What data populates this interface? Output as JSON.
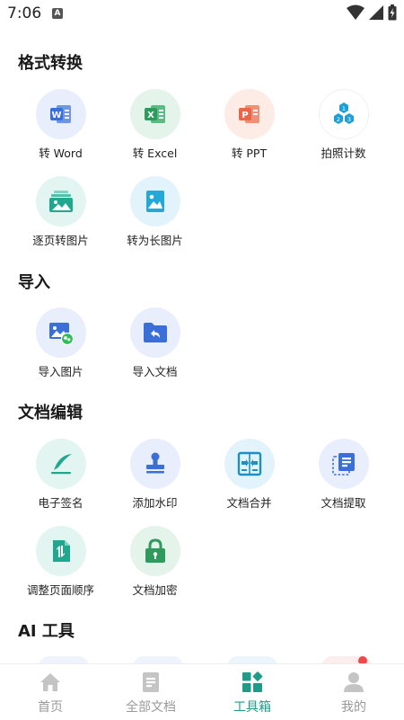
{
  "status_bar": {
    "time": "7:06",
    "badge": "A"
  },
  "colors": {
    "accent": "#1f9b8a",
    "word": "#3b6fd8",
    "excel": "#2e9a5b",
    "ppt": "#e8664a",
    "tab_inactive": "#999999"
  },
  "sections": {
    "format": {
      "title": "格式转换",
      "items": [
        "转 Word",
        "转 Excel",
        "转 PPT",
        "拍照计数",
        "逐页转图片",
        "转为长图片"
      ]
    },
    "import": {
      "title": "导入",
      "items": [
        "导入图片",
        "导入文档"
      ]
    },
    "edit": {
      "title": "文档编辑",
      "items": [
        "电子签名",
        "添加水印",
        "文档合并",
        "文档提取",
        "调整页面顺序",
        "文档加密"
      ]
    },
    "ai": {
      "title": "AI 工具"
    }
  },
  "tabbar": {
    "items": [
      "首页",
      "全部文档",
      "工具箱",
      "我的"
    ],
    "active": "工具箱"
  }
}
